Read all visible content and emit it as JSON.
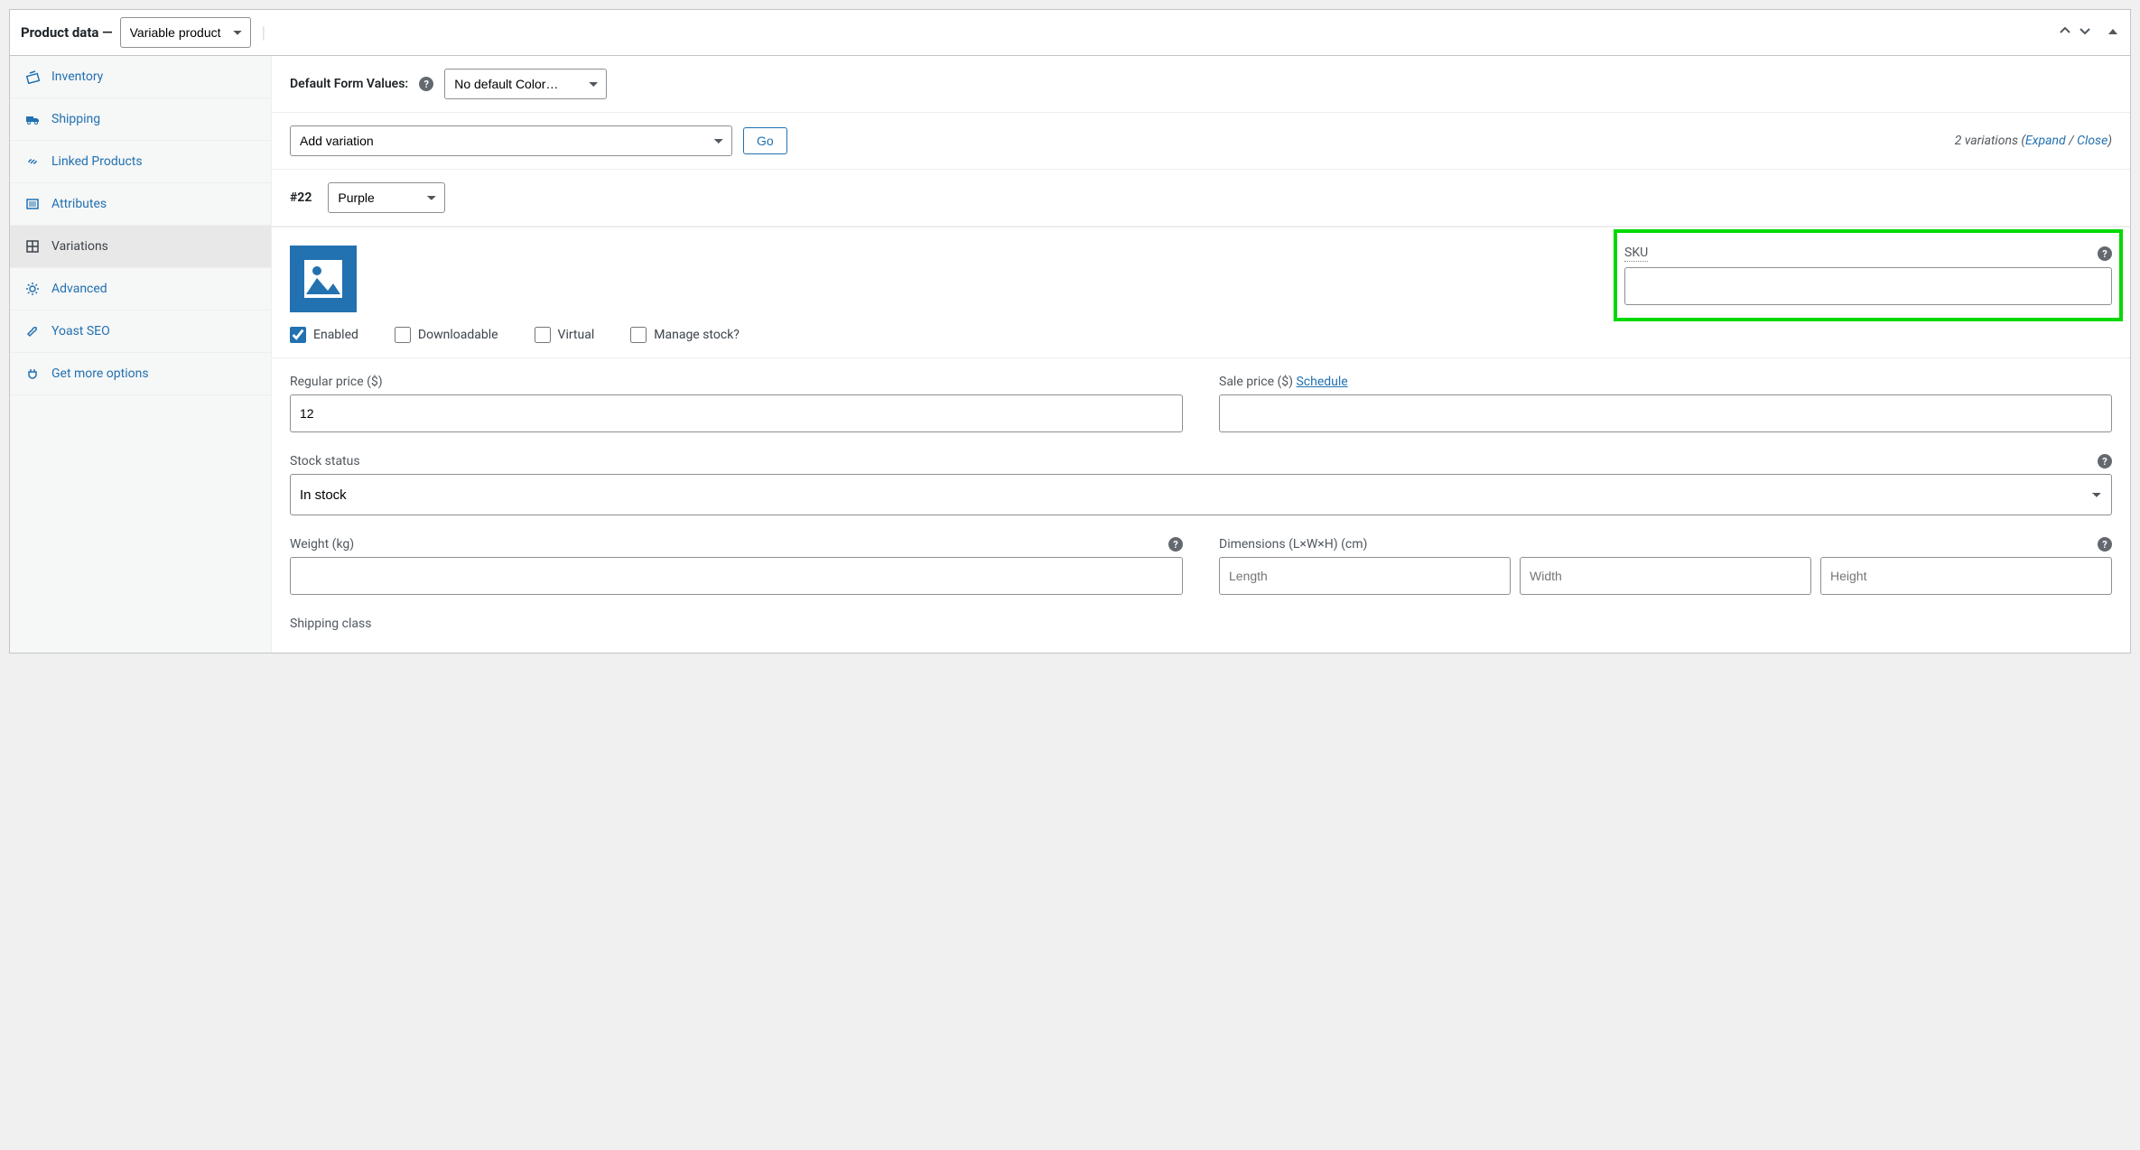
{
  "header": {
    "title": "Product data —",
    "product_type": "Variable product"
  },
  "sidebar": {
    "items": [
      {
        "label": "Inventory"
      },
      {
        "label": "Shipping"
      },
      {
        "label": "Linked Products"
      },
      {
        "label": "Attributes"
      },
      {
        "label": "Variations"
      },
      {
        "label": "Advanced"
      },
      {
        "label": "Yoast SEO"
      },
      {
        "label": "Get more options"
      }
    ]
  },
  "defaults": {
    "label": "Default Form Values:",
    "select_value": "No default Color…"
  },
  "actions": {
    "add_variation": "Add variation",
    "go": "Go",
    "variations_count_prefix": "2 variations (",
    "expand": "Expand",
    "sep": " / ",
    "close": "Close",
    "suffix": ")"
  },
  "variation": {
    "id": "#22",
    "attr_value": "Purple",
    "sku_label": "SKU",
    "sku_value": "",
    "enabled_label": "Enabled",
    "downloadable_label": "Downloadable",
    "virtual_label": "Virtual",
    "manage_stock_label": "Manage stock?",
    "regular_price_label": "Regular price ($)",
    "regular_price_value": "12",
    "sale_price_label": "Sale price ($) ",
    "schedule": "Schedule",
    "sale_price_value": "",
    "stock_status_label": "Stock status",
    "stock_status_value": "In stock",
    "weight_label": "Weight (kg)",
    "weight_value": "",
    "dimensions_label": "Dimensions (L×W×H) (cm)",
    "length_ph": "Length",
    "width_ph": "Width",
    "height_ph": "Height",
    "shipping_class_label": "Shipping class"
  }
}
